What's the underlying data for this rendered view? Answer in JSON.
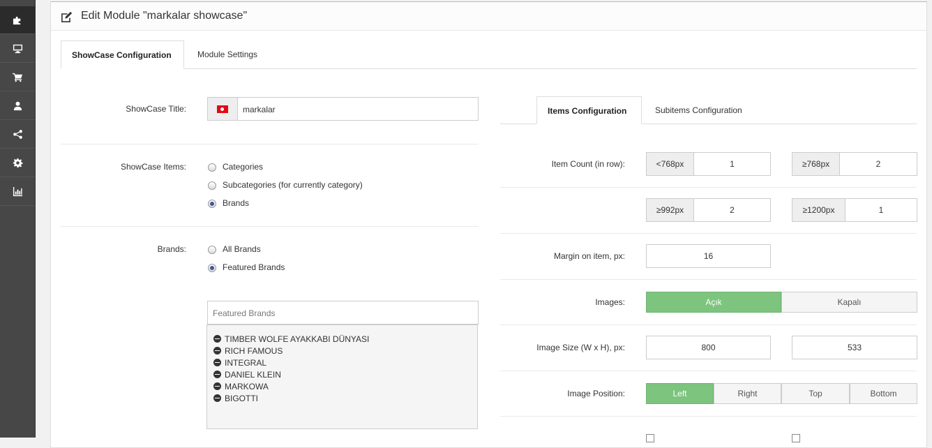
{
  "header": {
    "title": "Edit Module \"markalar showcase\""
  },
  "tabs": [
    {
      "label": "ShowCase Configuration"
    },
    {
      "label": "Module Settings"
    }
  ],
  "left": {
    "title_label": "ShowCase Title:",
    "title_value": "markalar",
    "items_label": "ShowCase Items:",
    "items_options": [
      {
        "label": "Categories",
        "selected": false
      },
      {
        "label": "Subcategories (for currently category)",
        "selected": false
      },
      {
        "label": "Brands",
        "selected": true
      }
    ],
    "brands_label": "Brands:",
    "brands_options": [
      {
        "label": "All Brands",
        "selected": false
      },
      {
        "label": "Featured Brands",
        "selected": true
      }
    ],
    "featured_placeholder": "Featured Brands",
    "featured_list": [
      "TIMBER WOLFE AYAKKABI DÜNYASI",
      "RICH FAMOUS",
      "INTEGRAL",
      "DANIEL KLEIN",
      "MARKOWA",
      "BIGOTTI"
    ]
  },
  "right": {
    "subtabs": [
      {
        "label": "Items Configuration"
      },
      {
        "label": "Subitems Configuration"
      }
    ],
    "item_count_label": "Item Count (in row):",
    "counts": [
      {
        "prefix": "<768px",
        "value": "1"
      },
      {
        "prefix": "≥768px",
        "value": "2"
      },
      {
        "prefix": "≥992px",
        "value": "2"
      },
      {
        "prefix": "≥1200px",
        "value": "1"
      }
    ],
    "margin_label": "Margin on item, px:",
    "margin_value": "16",
    "images_label": "Images:",
    "images_options": [
      "Açık",
      "Kapalı"
    ],
    "image_size_label": "Image Size (W x H), px:",
    "image_width": "800",
    "image_height": "533",
    "image_position_label": "Image Position:",
    "image_position_options": [
      "Left",
      "Right",
      "Top",
      "Bottom"
    ]
  },
  "colors": {
    "accent_green": "#7dc47f",
    "sidebar": "#474747"
  }
}
